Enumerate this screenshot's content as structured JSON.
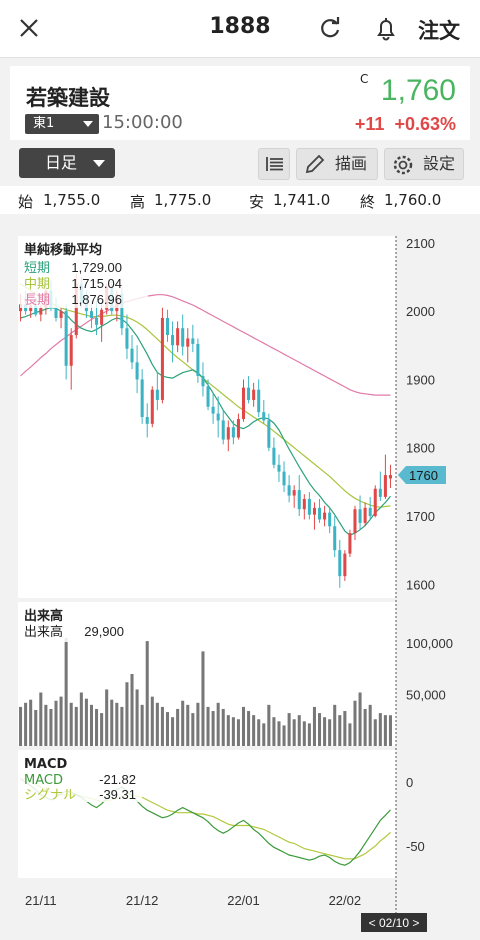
{
  "header": {
    "code": "1888",
    "order_label": "注文"
  },
  "stock": {
    "name": "若築建設",
    "market": "東1",
    "time": "15:00:00",
    "c_mark": "C",
    "price": "1,760",
    "change": "+11",
    "change_pct": "+0.63%"
  },
  "toolbar": {
    "period": "日足",
    "draw_label": "描画",
    "settings_label": "設定"
  },
  "ohlc": {
    "open_label": "始",
    "open": "1,755.0",
    "high_label": "高",
    "high": "1,775.0",
    "low_label": "安",
    "low": "1,741.0",
    "close_label": "終",
    "close": "1,760.0"
  },
  "colors": {
    "up": "#e04848",
    "down": "#3bb3c3",
    "short_ma": "#2aa27b",
    "mid_ma": "#a8c43c",
    "long_ma": "#e07aa8",
    "volume": "#777777",
    "macd": "#3a9a3a",
    "signal": "#b2c83a",
    "price_tag": "#58b9cf"
  },
  "chart_data": [
    {
      "type": "candlestick",
      "title": "単純移動平均",
      "legend": [
        {
          "name": "短期",
          "value": "1,729.00"
        },
        {
          "name": "中期",
          "value": "1,715.04"
        },
        {
          "name": "長期",
          "value": "1,876.96"
        }
      ],
      "y_ticks": [
        "2100",
        "2000",
        "1900",
        "1800",
        "1700",
        "1600"
      ],
      "ylim": [
        1580,
        2110
      ],
      "current_price_label": "1760",
      "x_ticks": [
        "21/11",
        "21/12",
        "22/01",
        "22/02"
      ],
      "cursor_label": "< 02/10 >",
      "candles": [
        [
          2000,
          2025,
          1985,
          2010
        ],
        [
          2010,
          2030,
          1995,
          2000
        ],
        [
          2000,
          2015,
          1990,
          2008
        ],
        [
          2008,
          2020,
          1992,
          1995
        ],
        [
          1995,
          2010,
          1985,
          2005
        ],
        [
          2005,
          2040,
          1995,
          2030
        ],
        [
          2030,
          2045,
          2000,
          2005
        ],
        [
          2005,
          2020,
          1985,
          1990
        ],
        [
          1990,
          2005,
          1975,
          2000
        ],
        [
          2000,
          2010,
          1900,
          1920
        ],
        [
          1920,
          1975,
          1885,
          1965
        ],
        [
          1965,
          2055,
          1960,
          2040
        ],
        [
          2040,
          2050,
          2005,
          2012
        ],
        [
          2012,
          2030,
          1990,
          2000
        ],
        [
          2000,
          2010,
          1975,
          1990
        ],
        [
          1990,
          2015,
          1965,
          1980
        ],
        [
          1980,
          2010,
          1955,
          2002
        ],
        [
          2002,
          2040,
          1995,
          2035
        ],
        [
          2035,
          2045,
          1995,
          2000
        ],
        [
          2000,
          2030,
          1985,
          2025
        ],
        [
          2025,
          2035,
          1965,
          1975
        ],
        [
          1975,
          1995,
          1930,
          1945
        ],
        [
          1945,
          1965,
          1915,
          1925
        ],
        [
          1925,
          1950,
          1880,
          1900
        ],
        [
          1900,
          1915,
          1835,
          1845
        ],
        [
          1845,
          1865,
          1815,
          1835
        ],
        [
          1835,
          1890,
          1830,
          1885
        ],
        [
          1885,
          1910,
          1855,
          1870
        ],
        [
          1870,
          2005,
          1865,
          1990
        ],
        [
          1990,
          2002,
          1955,
          1965
        ],
        [
          1965,
          1985,
          1925,
          1950
        ],
        [
          1950,
          1985,
          1940,
          1975
        ],
        [
          1975,
          1995,
          1935,
          1948
        ],
        [
          1948,
          1975,
          1925,
          1960
        ],
        [
          1960,
          1980,
          1940,
          1952
        ],
        [
          1952,
          1960,
          1895,
          1905
        ],
        [
          1905,
          1925,
          1875,
          1890
        ],
        [
          1890,
          1900,
          1855,
          1860
        ],
        [
          1860,
          1880,
          1835,
          1850
        ],
        [
          1850,
          1875,
          1815,
          1840
        ],
        [
          1840,
          1855,
          1805,
          1812
        ],
        [
          1812,
          1840,
          1795,
          1830
        ],
        [
          1830,
          1840,
          1805,
          1815
        ],
        [
          1815,
          1850,
          1812,
          1842
        ],
        [
          1842,
          1900,
          1838,
          1888
        ],
        [
          1888,
          1905,
          1865,
          1870
        ],
        [
          1870,
          1895,
          1860,
          1885
        ],
        [
          1885,
          1900,
          1845,
          1852
        ],
        [
          1852,
          1870,
          1835,
          1840
        ],
        [
          1840,
          1850,
          1795,
          1800
        ],
        [
          1800,
          1815,
          1770,
          1775
        ],
        [
          1775,
          1790,
          1750,
          1765
        ],
        [
          1765,
          1780,
          1735,
          1745
        ],
        [
          1745,
          1760,
          1720,
          1730
        ],
        [
          1730,
          1745,
          1712,
          1738
        ],
        [
          1738,
          1760,
          1700,
          1710
        ],
        [
          1710,
          1732,
          1695,
          1725
        ],
        [
          1725,
          1735,
          1695,
          1702
        ],
        [
          1702,
          1720,
          1680,
          1712
        ],
        [
          1712,
          1725,
          1690,
          1695
        ],
        [
          1695,
          1715,
          1685,
          1705
        ],
        [
          1705,
          1712,
          1675,
          1685
        ],
        [
          1685,
          1700,
          1640,
          1650
        ],
        [
          1650,
          1665,
          1595,
          1612
        ],
        [
          1612,
          1650,
          1605,
          1645
        ],
        [
          1645,
          1680,
          1640,
          1675
        ],
        [
          1675,
          1715,
          1665,
          1710
        ],
        [
          1710,
          1730,
          1680,
          1690
        ],
        [
          1690,
          1720,
          1685,
          1712
        ],
        [
          1712,
          1728,
          1695,
          1700
        ],
        [
          1700,
          1745,
          1698,
          1740
        ],
        [
          1740,
          1765,
          1722,
          1728
        ],
        [
          1728,
          1790,
          1725,
          1760
        ],
        [
          1755,
          1775,
          1741,
          1760
        ]
      ],
      "short_ma": [
        1990,
        1992,
        1995,
        1998,
        2000,
        2003,
        2005,
        2004,
        2000,
        1995,
        1987,
        1980,
        1975,
        1972,
        1970,
        1973,
        1978,
        1982,
        1987,
        1990,
        1988,
        1982,
        1973,
        1963,
        1950,
        1937,
        1922,
        1910,
        1905,
        1903,
        1902,
        1906,
        1910,
        1912,
        1914,
        1910,
        1902,
        1892,
        1880,
        1868,
        1855,
        1845,
        1835,
        1830,
        1828,
        1832,
        1838,
        1842,
        1844,
        1842,
        1836,
        1826,
        1812,
        1798,
        1785,
        1772,
        1760,
        1748,
        1738,
        1730,
        1720,
        1712,
        1702,
        1690,
        1678,
        1672,
        1675,
        1680,
        1686,
        1695,
        1705,
        1712,
        1720,
        1729
      ],
      "mid_ma": [
        2040,
        2035,
        2030,
        2025,
        2020,
        2015,
        2012,
        2008,
        2005,
        2002,
        2000,
        1998,
        1996,
        1994,
        1992,
        1992,
        1992,
        1993,
        1994,
        1994,
        1993,
        1991,
        1988,
        1984,
        1979,
        1973,
        1966,
        1959,
        1952,
        1945,
        1938,
        1932,
        1926,
        1920,
        1914,
        1908,
        1902,
        1896,
        1890,
        1884,
        1878,
        1872,
        1866,
        1860,
        1855,
        1850,
        1845,
        1840,
        1835,
        1830,
        1824,
        1818,
        1812,
        1806,
        1800,
        1794,
        1788,
        1782,
        1776,
        1770,
        1764,
        1758,
        1751,
        1744,
        1737,
        1731,
        1726,
        1722,
        1719,
        1716,
        1714,
        1713,
        1714,
        1715
      ],
      "long_ma": [
        1905,
        1912,
        1918,
        1925,
        1932,
        1938,
        1945,
        1951,
        1957,
        1962,
        1968,
        1973,
        1978,
        1983,
        1988,
        1992,
        1996,
        2000,
        2004,
        2008,
        2011,
        2014,
        2016,
        2018,
        2020,
        2022,
        2023,
        2024,
        2024,
        2023,
        2021,
        2018,
        2015,
        2012,
        2009,
        2005,
        2001,
        1997,
        1993,
        1989,
        1985,
        1981,
        1977,
        1973,
        1969,
        1965,
        1961,
        1957,
        1953,
        1949,
        1945,
        1941,
        1937,
        1933,
        1929,
        1925,
        1921,
        1917,
        1913,
        1909,
        1905,
        1901,
        1897,
        1893,
        1889,
        1885,
        1882,
        1880,
        1879,
        1878,
        1877,
        1877,
        1877,
        1877
      ]
    },
    {
      "type": "bar",
      "title": "出来高",
      "legend": [
        {
          "name": "出来高",
          "value": "29,900"
        }
      ],
      "y_ticks": [
        "100,000",
        "50,000"
      ],
      "ylim": [
        0,
        140000
      ],
      "values": [
        38000,
        42000,
        45000,
        35000,
        52000,
        40000,
        36000,
        44000,
        48000,
        105000,
        42000,
        38000,
        52000,
        46000,
        40000,
        36000,
        32000,
        55000,
        45000,
        42000,
        38000,
        62000,
        70000,
        55000,
        40000,
        102000,
        48000,
        42000,
        38000,
        33000,
        28000,
        36000,
        44000,
        40000,
        32000,
        42000,
        92000,
        38000,
        34000,
        42000,
        36000,
        30000,
        28000,
        26000,
        38000,
        34000,
        30000,
        26000,
        22000,
        40000,
        28000,
        24000,
        20000,
        32000,
        26000,
        30000,
        24000,
        22000,
        38000,
        32000,
        28000,
        26000,
        40000,
        30000,
        34000,
        22000,
        44000,
        52000,
        36000,
        40000,
        26000,
        32000,
        30000,
        29900
      ]
    },
    {
      "type": "line",
      "title": "MACD",
      "legend": [
        {
          "name": "MACD",
          "value": "-21.82"
        },
        {
          "name": "シグナル",
          "value": "-39.31"
        }
      ],
      "y_ticks": [
        "0",
        "-50"
      ],
      "ylim": [
        -75,
        25
      ],
      "macd": [
        2,
        0,
        -3,
        -6,
        -10,
        -12,
        -14,
        -12,
        -9,
        -7,
        -8,
        -10,
        -12,
        -15,
        -18,
        -20,
        -17,
        -13,
        -9,
        -6,
        -4,
        -7,
        -11,
        -15,
        -19,
        -22,
        -24,
        -26,
        -28,
        -27,
        -25,
        -22,
        -20,
        -22,
        -24,
        -26,
        -28,
        -31,
        -35,
        -38,
        -40,
        -38,
        -35,
        -32,
        -30,
        -33,
        -37,
        -40,
        -44,
        -48,
        -51,
        -53,
        -55,
        -57,
        -58,
        -59,
        -60,
        -61,
        -60,
        -58,
        -57,
        -59,
        -62,
        -64,
        -65,
        -63,
        -59,
        -54,
        -48,
        -42,
        -36,
        -30,
        -26,
        -21.82
      ],
      "signal": [
        3,
        2,
        0,
        -2,
        -4,
        -6,
        -8,
        -9,
        -10,
        -10,
        -10,
        -10,
        -11,
        -12,
        -13,
        -14,
        -15,
        -15,
        -14,
        -13,
        -11,
        -10,
        -10,
        -11,
        -12,
        -14,
        -16,
        -18,
        -20,
        -22,
        -23,
        -24,
        -24,
        -24,
        -24,
        -25,
        -25,
        -26,
        -27,
        -29,
        -31,
        -33,
        -34,
        -34,
        -34,
        -34,
        -35,
        -36,
        -37,
        -39,
        -41,
        -43,
        -45,
        -47,
        -48,
        -50,
        -52,
        -53,
        -54,
        -55,
        -56,
        -57,
        -58,
        -59,
        -60,
        -60,
        -60,
        -58,
        -56,
        -53,
        -50,
        -46,
        -43,
        -39.31
      ]
    }
  ]
}
